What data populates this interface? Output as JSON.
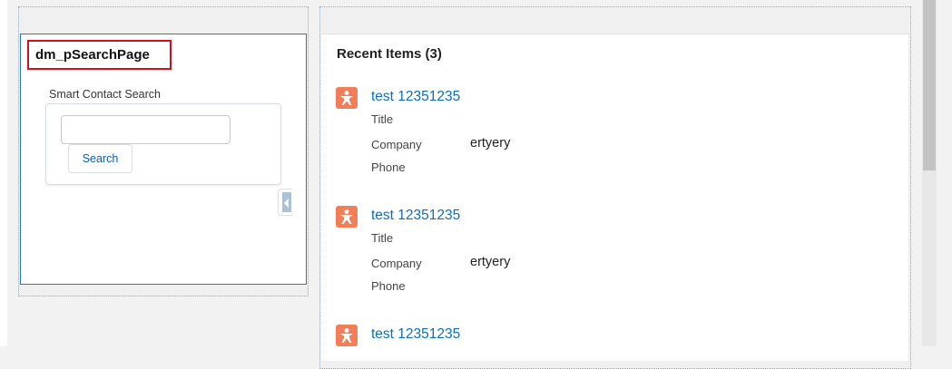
{
  "left_panel": {
    "page_title": "dm_pSearchPage",
    "search_label": "Smart Contact Search",
    "search_input_value": "",
    "search_button_label": "Search"
  },
  "recent_items": {
    "title": "Recent Items (3)",
    "items": [
      {
        "name": "test 12351235",
        "title_label": "Title",
        "company_label": "Company",
        "company_value": "ertyery",
        "phone_label": "Phone"
      },
      {
        "name": "test 12351235",
        "title_label": "Title",
        "company_label": "Company",
        "company_value": "ertyery",
        "phone_label": "Phone"
      },
      {
        "name": "test 12351235"
      }
    ]
  },
  "colors": {
    "contact_icon": "#f17e59",
    "link": "#0b6fb8",
    "highlight_box": "#d0101a"
  },
  "icons": {
    "contact": "contact-icon",
    "collapse": "chevron-left-icon"
  }
}
